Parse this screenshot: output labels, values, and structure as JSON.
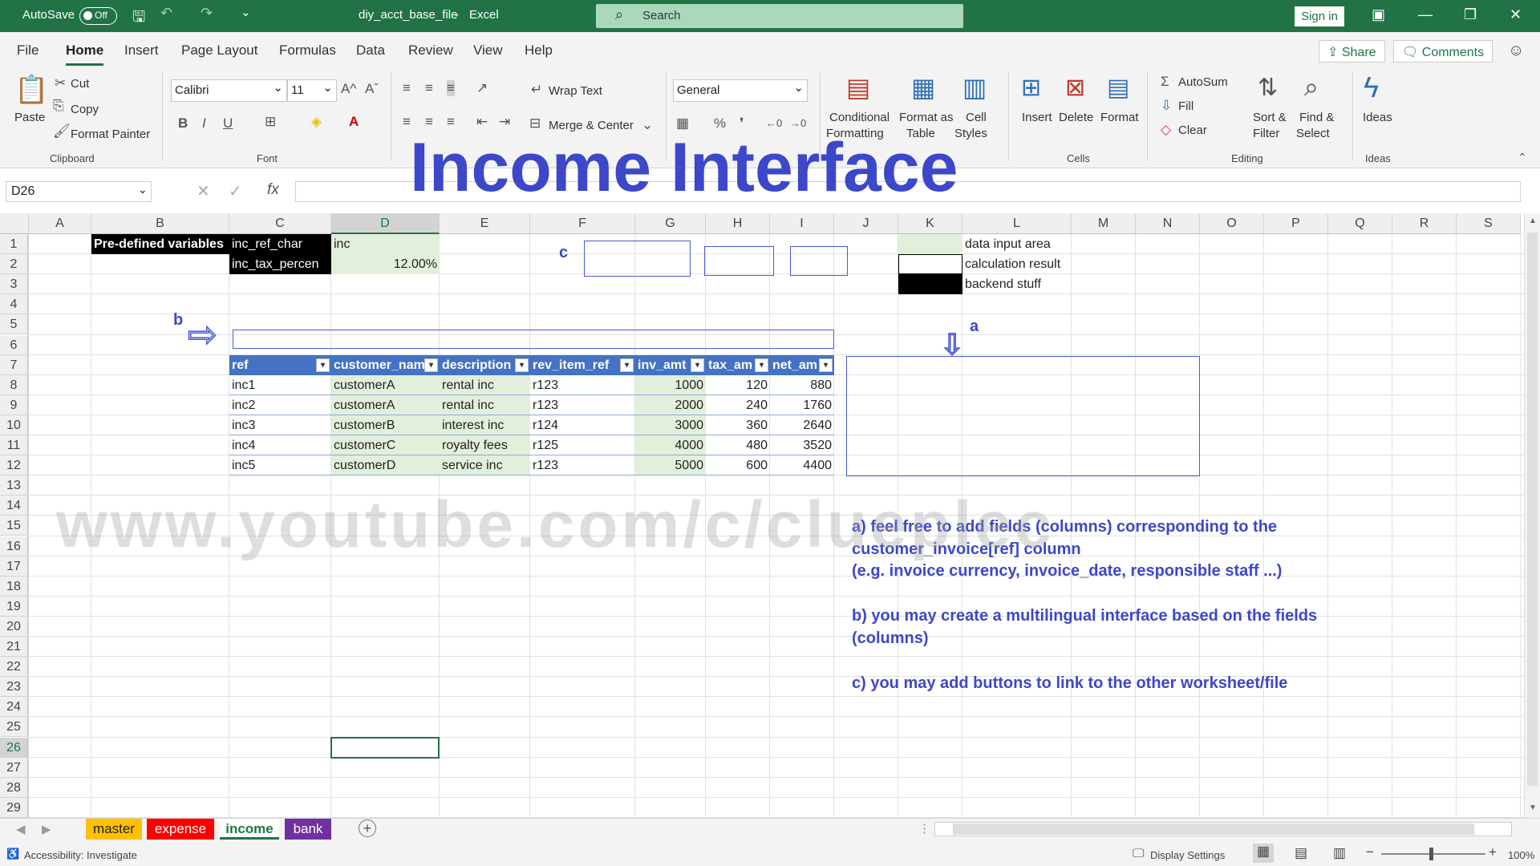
{
  "titlebar": {
    "autosave_label": "AutoSave",
    "autosave_state": "Off",
    "filename": "diy_acct_base_file",
    "separator": "-",
    "app": "Excel",
    "search_placeholder": "Search",
    "signin_label": "Sign in"
  },
  "menu": {
    "items": [
      "File",
      "Home",
      "Insert",
      "Page Layout",
      "Formulas",
      "Data",
      "Review",
      "View",
      "Help"
    ],
    "active": "Home",
    "share_label": "Share",
    "comments_label": "Comments"
  },
  "ribbon": {
    "clipboard": {
      "paste": "Paste",
      "cut": "Cut",
      "copy": "Copy",
      "format_painter": "Format Painter",
      "group": "Clipboard"
    },
    "font": {
      "name": "Calibri",
      "size": "11",
      "group": "Font"
    },
    "alignment": {
      "wrap_text": "Wrap Text",
      "merge_center": "Merge & Center"
    },
    "number": {
      "format": "General"
    },
    "styles": {
      "conditional_1": "Conditional",
      "conditional_2": "Formatting",
      "format_table_1": "Format as",
      "format_table_2": "Table",
      "cell_styles_1": "Cell",
      "cell_styles_2": "Styles"
    },
    "cells": {
      "insert": "Insert",
      "delete": "Delete",
      "format": "Format",
      "group": "Cells"
    },
    "editing": {
      "autosum": "AutoSum",
      "fill": "Fill",
      "clear": "Clear",
      "sort_1": "Sort &",
      "sort_2": "Filter",
      "find_1": "Find &",
      "find_2": "Select",
      "group": "Editing"
    },
    "ideas": {
      "label": "Ideas",
      "group": "Ideas"
    }
  },
  "formula_bar": {
    "name_box": "D26",
    "formula": ""
  },
  "overlay_title": "Income Interface",
  "watermark": "www.youtube.com/c/clueplec",
  "columns": [
    "A",
    "B",
    "C",
    "D",
    "E",
    "F",
    "G",
    "H",
    "I",
    "J",
    "K",
    "L",
    "M",
    "N",
    "O",
    "P",
    "Q",
    "R",
    "S"
  ],
  "rows": [
    "1",
    "2",
    "3",
    "4",
    "5",
    "6",
    "7",
    "8",
    "9",
    "10",
    "11",
    "12",
    "13",
    "14",
    "15",
    "16",
    "17",
    "18",
    "19",
    "20",
    "21",
    "22",
    "23",
    "24",
    "25",
    "26",
    "27",
    "28",
    "29"
  ],
  "selected_cell": "D26",
  "predefined": {
    "title": "Pre-defined variables",
    "var1_name": "inc_ref_char",
    "var1_value": "inc",
    "var2_name": "inc_tax_percen",
    "var2_value": "12.00%"
  },
  "legend": {
    "input": "data input area",
    "calc": "calculation result",
    "backend": "backend stuff"
  },
  "table": {
    "headers": [
      "ref",
      "customer_nam",
      "description",
      "rev_item_ref",
      "inv_amt",
      "tax_am",
      "net_am"
    ],
    "rows": [
      [
        "inc1",
        "customerA",
        "rental inc",
        "r123",
        "1000",
        "120",
        "880"
      ],
      [
        "inc2",
        "customerA",
        "rental inc",
        "r123",
        "2000",
        "240",
        "1760"
      ],
      [
        "inc3",
        "customerB",
        "interest inc",
        "r124",
        "3000",
        "360",
        "2640"
      ],
      [
        "inc4",
        "customerC",
        "royalty fees",
        "r125",
        "4000",
        "480",
        "3520"
      ],
      [
        "inc5",
        "customerD",
        "service inc",
        "r123",
        "5000",
        "600",
        "4400"
      ]
    ]
  },
  "labels": {
    "a": "a",
    "b": "b",
    "c": "c"
  },
  "notes": [
    "a) feel free to add fields (columns) corresponding to the",
    "customer_invoice[ref] column",
    "(e.g. invoice currency, invoice_date, responsible staff ...)",
    "b) you may create a multilingual interface based on the fields",
    "(columns)",
    "c) you may add buttons to link to the other worksheet/file"
  ],
  "sheets": [
    {
      "name": "master",
      "color": "#ffc000"
    },
    {
      "name": "expense",
      "color": "#ff0000"
    },
    {
      "name": "income",
      "color": "#ffffff"
    },
    {
      "name": "bank",
      "color": "#7030a0"
    }
  ],
  "status": {
    "accessibility": "Accessibility: Investigate",
    "display_settings": "Display Settings",
    "zoom": "100%"
  }
}
